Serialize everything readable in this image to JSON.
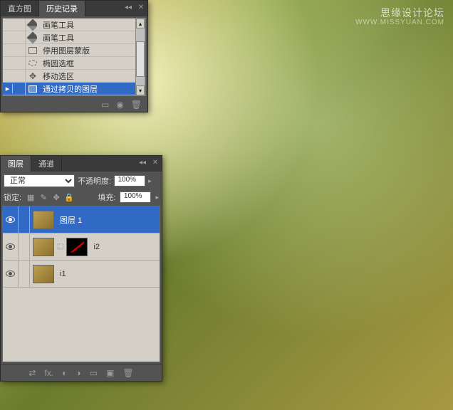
{
  "watermark": {
    "title": "思缘设计论坛",
    "url": "WWW.MISSYUAN.COM"
  },
  "history": {
    "tabs": [
      "直方图",
      "历史记录"
    ],
    "active_tab": 1,
    "items": [
      {
        "icon": "brush",
        "label": "画笔工具"
      },
      {
        "icon": "brush",
        "label": "画笔工具"
      },
      {
        "icon": "mask",
        "label": "停用图层蒙版"
      },
      {
        "icon": "ellipse",
        "label": "椭圆选框"
      },
      {
        "icon": "move",
        "label": "移动选区"
      },
      {
        "icon": "layer",
        "label": "通过拷贝的图层"
      }
    ],
    "selected": 5
  },
  "layers": {
    "tabs": [
      "图层",
      "通道"
    ],
    "active_tab": 0,
    "blend_mode": "正常",
    "opacity_label": "不透明度:",
    "opacity_value": "100%",
    "lock_label": "锁定:",
    "fill_label": "填充:",
    "fill_value": "100%",
    "items": [
      {
        "name": "图层 1",
        "has_mask": false,
        "vis": true
      },
      {
        "name": "i2",
        "has_mask": true,
        "vis": true
      },
      {
        "name": "i1",
        "has_mask": false,
        "vis": true
      }
    ],
    "selected": 0
  }
}
